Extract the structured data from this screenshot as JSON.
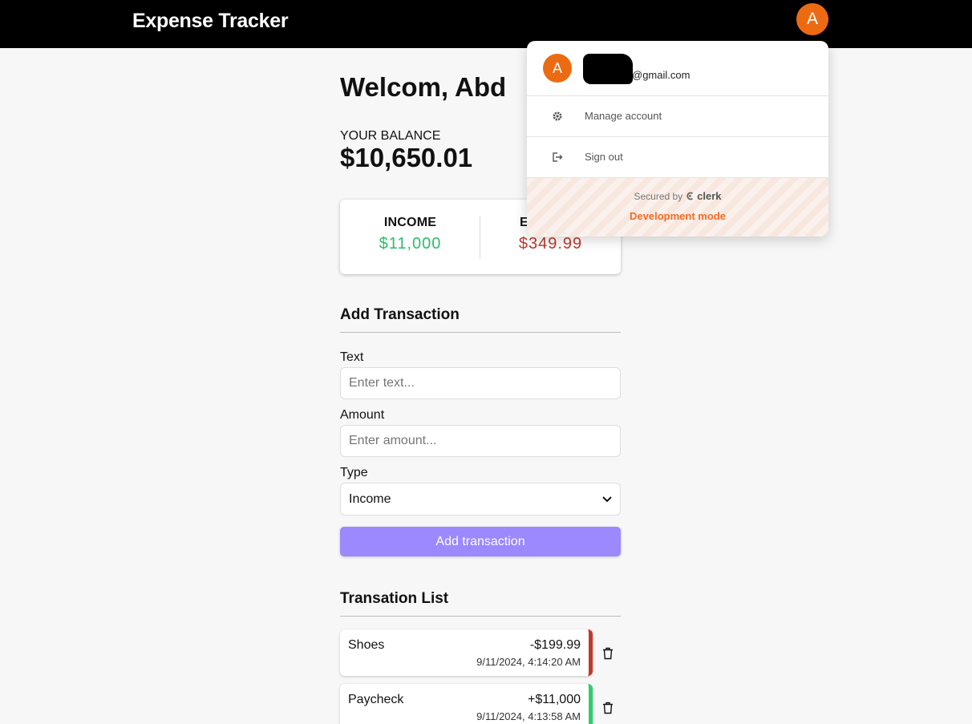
{
  "header": {
    "app_title": "Expense Tracker",
    "avatar_initial": "A"
  },
  "main": {
    "welcome": "Welcom, Abd",
    "balance_label": "YOUR BALANCE",
    "balance_value": "$10,650.01",
    "summary": {
      "income_label": "INCOME",
      "income_value": "$11,000",
      "expense_label": "EXPENSE",
      "expense_value": "$349.99"
    },
    "form": {
      "title": "Add Transaction",
      "text_label": "Text",
      "text_placeholder": "Enter text...",
      "amount_label": "Amount",
      "amount_placeholder": "Enter amount...",
      "type_label": "Type",
      "type_value": "Income",
      "submit_label": "Add transaction"
    },
    "list": {
      "title": "Transation List",
      "items": [
        {
          "text": "Shoes",
          "amount": "-$199.99",
          "date": "9/11/2024, 4:14:20 AM",
          "kind": "expense"
        },
        {
          "text": "Paycheck",
          "amount": "+$11,000",
          "date": "9/11/2024, 4:13:58 AM",
          "kind": "income"
        }
      ]
    }
  },
  "user_menu": {
    "avatar_initial": "A",
    "email_suffix": "@gmail.com",
    "manage_label": "Manage account",
    "signout_label": "Sign out",
    "secured_by": "Secured by",
    "clerk_brand": "clerk",
    "dev_mode": "Development mode"
  },
  "colors": {
    "navbar": "#000000",
    "avatar": "#ec6b12",
    "income": "#2ebc6a",
    "expense": "#c0392b",
    "button": "#9c88ff",
    "dev_mode": "#f36b24"
  }
}
